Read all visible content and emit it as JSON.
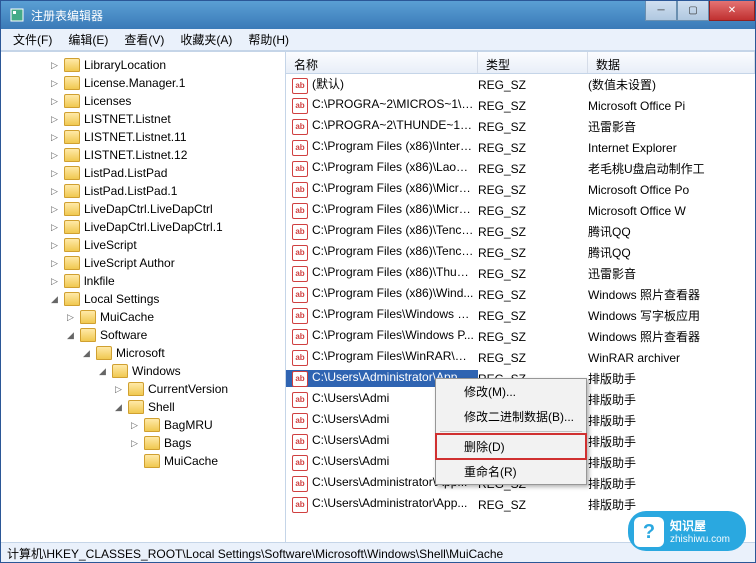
{
  "window": {
    "title": "注册表编辑器"
  },
  "menu": {
    "file": "文件(F)",
    "edit": "编辑(E)",
    "view": "查看(V)",
    "favorites": "收藏夹(A)",
    "help": "帮助(H)"
  },
  "tree": [
    {
      "indent": 3,
      "exp": "▷",
      "label": "LibraryLocation"
    },
    {
      "indent": 3,
      "exp": "▷",
      "label": "License.Manager.1"
    },
    {
      "indent": 3,
      "exp": "▷",
      "label": "Licenses"
    },
    {
      "indent": 3,
      "exp": "▷",
      "label": "LISTNET.Listnet"
    },
    {
      "indent": 3,
      "exp": "▷",
      "label": "LISTNET.Listnet.11"
    },
    {
      "indent": 3,
      "exp": "▷",
      "label": "LISTNET.Listnet.12"
    },
    {
      "indent": 3,
      "exp": "▷",
      "label": "ListPad.ListPad"
    },
    {
      "indent": 3,
      "exp": "▷",
      "label": "ListPad.ListPad.1"
    },
    {
      "indent": 3,
      "exp": "▷",
      "label": "LiveDapCtrl.LiveDapCtrl"
    },
    {
      "indent": 3,
      "exp": "▷",
      "label": "LiveDapCtrl.LiveDapCtrl.1"
    },
    {
      "indent": 3,
      "exp": "▷",
      "label": "LiveScript"
    },
    {
      "indent": 3,
      "exp": "▷",
      "label": "LiveScript Author"
    },
    {
      "indent": 3,
      "exp": "▷",
      "label": "lnkfile"
    },
    {
      "indent": 3,
      "exp": "◢",
      "label": "Local Settings"
    },
    {
      "indent": 4,
      "exp": "▷",
      "label": "MuiCache"
    },
    {
      "indent": 4,
      "exp": "◢",
      "label": "Software"
    },
    {
      "indent": 5,
      "exp": "◢",
      "label": "Microsoft"
    },
    {
      "indent": 6,
      "exp": "◢",
      "label": "Windows"
    },
    {
      "indent": 7,
      "exp": "▷",
      "label": "CurrentVersion"
    },
    {
      "indent": 7,
      "exp": "◢",
      "label": "Shell"
    },
    {
      "indent": 8,
      "exp": "▷",
      "label": "BagMRU"
    },
    {
      "indent": 8,
      "exp": "▷",
      "label": "Bags"
    },
    {
      "indent": 8,
      "exp": "",
      "label": "MuiCache"
    }
  ],
  "list": {
    "headers": {
      "name": "名称",
      "type": "类型",
      "data": "数据"
    },
    "rows": [
      {
        "name": "(默认)",
        "type": "REG_SZ",
        "data": "(数值未设置)"
      },
      {
        "name": "C:\\PROGRA~2\\MICROS~1\\O...",
        "type": "REG_SZ",
        "data": "Microsoft Office Pi"
      },
      {
        "name": "C:\\PROGRA~2\\THUNDE~1\\X...",
        "type": "REG_SZ",
        "data": "迅雷影音"
      },
      {
        "name": "C:\\Program Files (x86)\\Intern...",
        "type": "REG_SZ",
        "data": "Internet Explorer"
      },
      {
        "name": "C:\\Program Files (x86)\\LaoM...",
        "type": "REG_SZ",
        "data": "老毛桃U盘启动制作工"
      },
      {
        "name": "C:\\Program Files (x86)\\Micro...",
        "type": "REG_SZ",
        "data": "Microsoft Office Po"
      },
      {
        "name": "C:\\Program Files (x86)\\Micro...",
        "type": "REG_SZ",
        "data": "Microsoft Office W"
      },
      {
        "name": "C:\\Program Files (x86)\\Tence...",
        "type": "REG_SZ",
        "data": "腾讯QQ"
      },
      {
        "name": "C:\\Program Files (x86)\\Tence...",
        "type": "REG_SZ",
        "data": "腾讯QQ"
      },
      {
        "name": "C:\\Program Files (x86)\\Thund...",
        "type": "REG_SZ",
        "data": "迅雷影音"
      },
      {
        "name": "C:\\Program Files (x86)\\Wind...",
        "type": "REG_SZ",
        "data": "Windows 照片查看器"
      },
      {
        "name": "C:\\Program Files\\Windows N...",
        "type": "REG_SZ",
        "data": "Windows 写字板应用"
      },
      {
        "name": "C:\\Program Files\\Windows P...",
        "type": "REG_SZ",
        "data": "Windows 照片查看器"
      },
      {
        "name": "C:\\Program Files\\WinRAR\\Wi...",
        "type": "REG_SZ",
        "data": "WinRAR archiver"
      },
      {
        "name": "C:\\Users\\Administrator\\App...",
        "type": "REG_SZ",
        "data": "排版助手",
        "selected": true
      },
      {
        "name": "C:\\Users\\Admi",
        "type": "",
        "data": "排版助手"
      },
      {
        "name": "C:\\Users\\Admi",
        "type": "",
        "data": "排版助手"
      },
      {
        "name": "C:\\Users\\Admi",
        "type": "",
        "data": "排版助手"
      },
      {
        "name": "C:\\Users\\Admi",
        "type": "",
        "data": "排版助手"
      },
      {
        "name": "C:\\Users\\Administrator\\App...",
        "type": "REG_SZ",
        "data": "排版助手"
      },
      {
        "name": "C:\\Users\\Administrator\\App...",
        "type": "REG_SZ",
        "data": "排版助手"
      }
    ]
  },
  "context_menu": {
    "modify": "修改(M)...",
    "modify_binary": "修改二进制数据(B)...",
    "delete": "删除(D)",
    "rename": "重命名(R)"
  },
  "statusbar": "计算机\\HKEY_CLASSES_ROOT\\Local Settings\\Software\\Microsoft\\Windows\\Shell\\MuiCache",
  "watermark": {
    "name": "知识屋",
    "url": "zhishiwu.com",
    "logo": "?"
  }
}
